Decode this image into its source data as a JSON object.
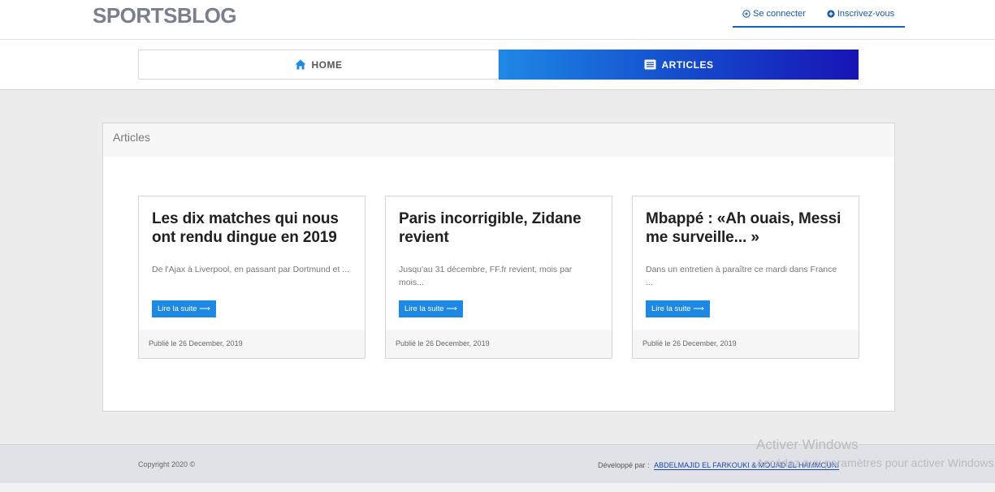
{
  "header": {
    "logo": "SPORTSBLOG",
    "login_label": "Se connecter",
    "signup_label": "Inscrivez-vous"
  },
  "nav": {
    "tabs": [
      {
        "label": "HOME",
        "icon": "home-icon",
        "active": false
      },
      {
        "label": "ARTICLES",
        "icon": "articles-icon",
        "active": true
      }
    ]
  },
  "colors": {
    "accent": "#1e88e5",
    "gradient_start": "#1e88e5",
    "gradient_end": "#1614b5"
  },
  "main": {
    "panel_title": "Articles",
    "articles": [
      {
        "title": "Les dix matches qui nous ont rendu dingue en 2019",
        "excerpt": "De l'Ajax à Liverpool, en passant par Dortmund et ...",
        "button": "Lire la suite ⟶",
        "published": "Publié le 26 December, 2019"
      },
      {
        "title": "Paris incorrigible, Zidane revient",
        "excerpt": "Jusqu'au 31 décembre, FF.fr revient, mois par mois...",
        "button": "Lire la suite ⟶",
        "published": "Publié le 26 December, 2019"
      },
      {
        "title": "Mbappé : «Ah ouais, Messi me surveille... »",
        "excerpt": "Dans un entretien à paraître ce mardi dans France ...",
        "button": "Lire la suite ⟶",
        "published": "Publié le 26 December, 2019"
      }
    ]
  },
  "footer": {
    "copyright": "Copyright 2020 ©",
    "dev_prefix": "Développé par :",
    "dev_names": "ABDELMAJID EL FARKOUKI & MOUAD EL HAMMOUNI"
  },
  "watermark": {
    "line1": "Activer Windows",
    "line2": "Accédez aux paramètres pour activer Windows."
  }
}
